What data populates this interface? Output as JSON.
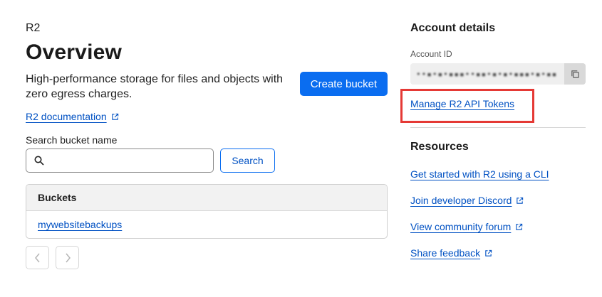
{
  "breadcrumb": "R2",
  "page_title": "Overview",
  "description": "High-performance storage for files and objects with zero egress charges.",
  "create_bucket_label": "Create bucket",
  "documentation_link": "R2 documentation",
  "search": {
    "label": "Search bucket name",
    "value": "",
    "button_label": "Search"
  },
  "table": {
    "header": "Buckets",
    "rows": [
      "mywebsitebackups"
    ]
  },
  "account": {
    "title": "Account details",
    "id_label": "Account ID",
    "id_value": "••▪•▪•▪▪▪••▪▪•▪•▪•▪▪▪•▪•▪▪",
    "manage_tokens": "Manage R2 API Tokens"
  },
  "resources": {
    "title": "Resources",
    "links": [
      "Get started with R2 using a CLI",
      "Join developer Discord",
      "View community forum",
      "Share feedback"
    ]
  },
  "colors": {
    "primary": "#0a6df0",
    "link": "#0051c3",
    "highlight": "#e53935"
  }
}
